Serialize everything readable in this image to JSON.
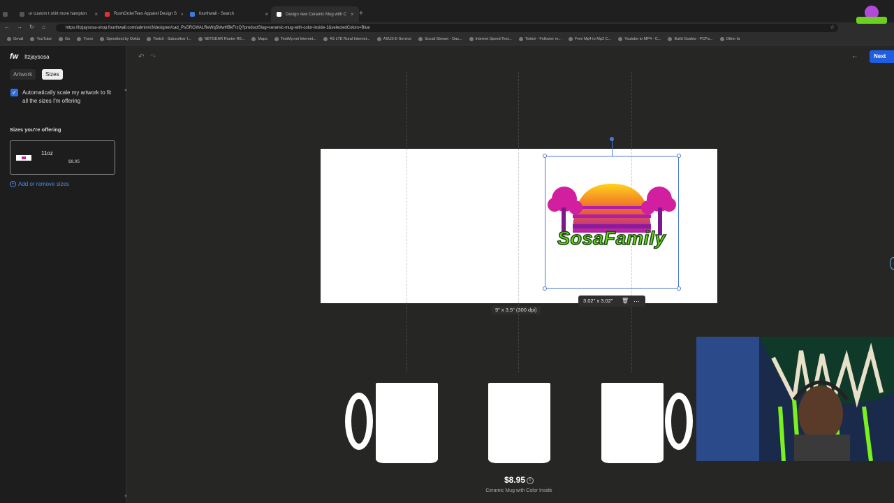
{
  "browser": {
    "tabs": [
      {
        "label": "ur custom t shirt more hampton"
      },
      {
        "label": "RushOrderTees Apparel Design S"
      },
      {
        "label": "fourthwall - Search"
      },
      {
        "label": "Design new Ceramic Mug with C",
        "active": true
      }
    ],
    "url": "https://itzjaysosa-shop.fourthwall.com/admin/v3/designer/cad_PsGRCWALReWq5MwHBkFrzQ?productSlug=ceramic-mug-with-color-inside-1&selectedColors=Blue",
    "bookmarks": [
      "Gmail",
      "YouTube",
      "Go",
      "Trovo",
      "Speedtest by Ookla",
      "Twitch - Subscriber I...",
      "NETGEAR Router R6...",
      "Maps",
      "TestMy.net Internet...",
      "4G LTE Rural Internet...",
      "ASUS E-Service",
      "Social Stream - Das...",
      "Internet Speed Test...",
      "Twitch - Follower re...",
      "Free Mp4 to Mp3 C...",
      "Youtube to MP4 - C...",
      "Build Guides - PCPa...",
      "Other fa"
    ]
  },
  "app": {
    "brand": "fw",
    "store_name": "Itzjaysosa",
    "tabs": {
      "artwork": "Artwork",
      "sizes": "Sizes"
    },
    "auto_scale_label": "Automatically scale my artwork to fit all the sizes I'm offering",
    "auto_scale_checked": true,
    "sizes_title": "Sizes you're offering",
    "sizes": [
      {
        "name": "11oz",
        "price": "$8.95"
      }
    ],
    "add_sizes_label": "Add or remove sizes",
    "next_label": "Next",
    "canvas": {
      "dimensions_label": "9\" x 3.5\" (300 dpi)",
      "selection_size_label": "3.02\" x 3.02\"",
      "artwork_text": "SosaFamily"
    },
    "product": {
      "price": "$8.95",
      "name": "Ceramic Mug with Color Inside"
    }
  },
  "colors": {
    "accent": "#1f5ee0",
    "selection": "#4a78d8",
    "logo_pink": "#d21fa0",
    "logo_green": "#6ad21e"
  }
}
